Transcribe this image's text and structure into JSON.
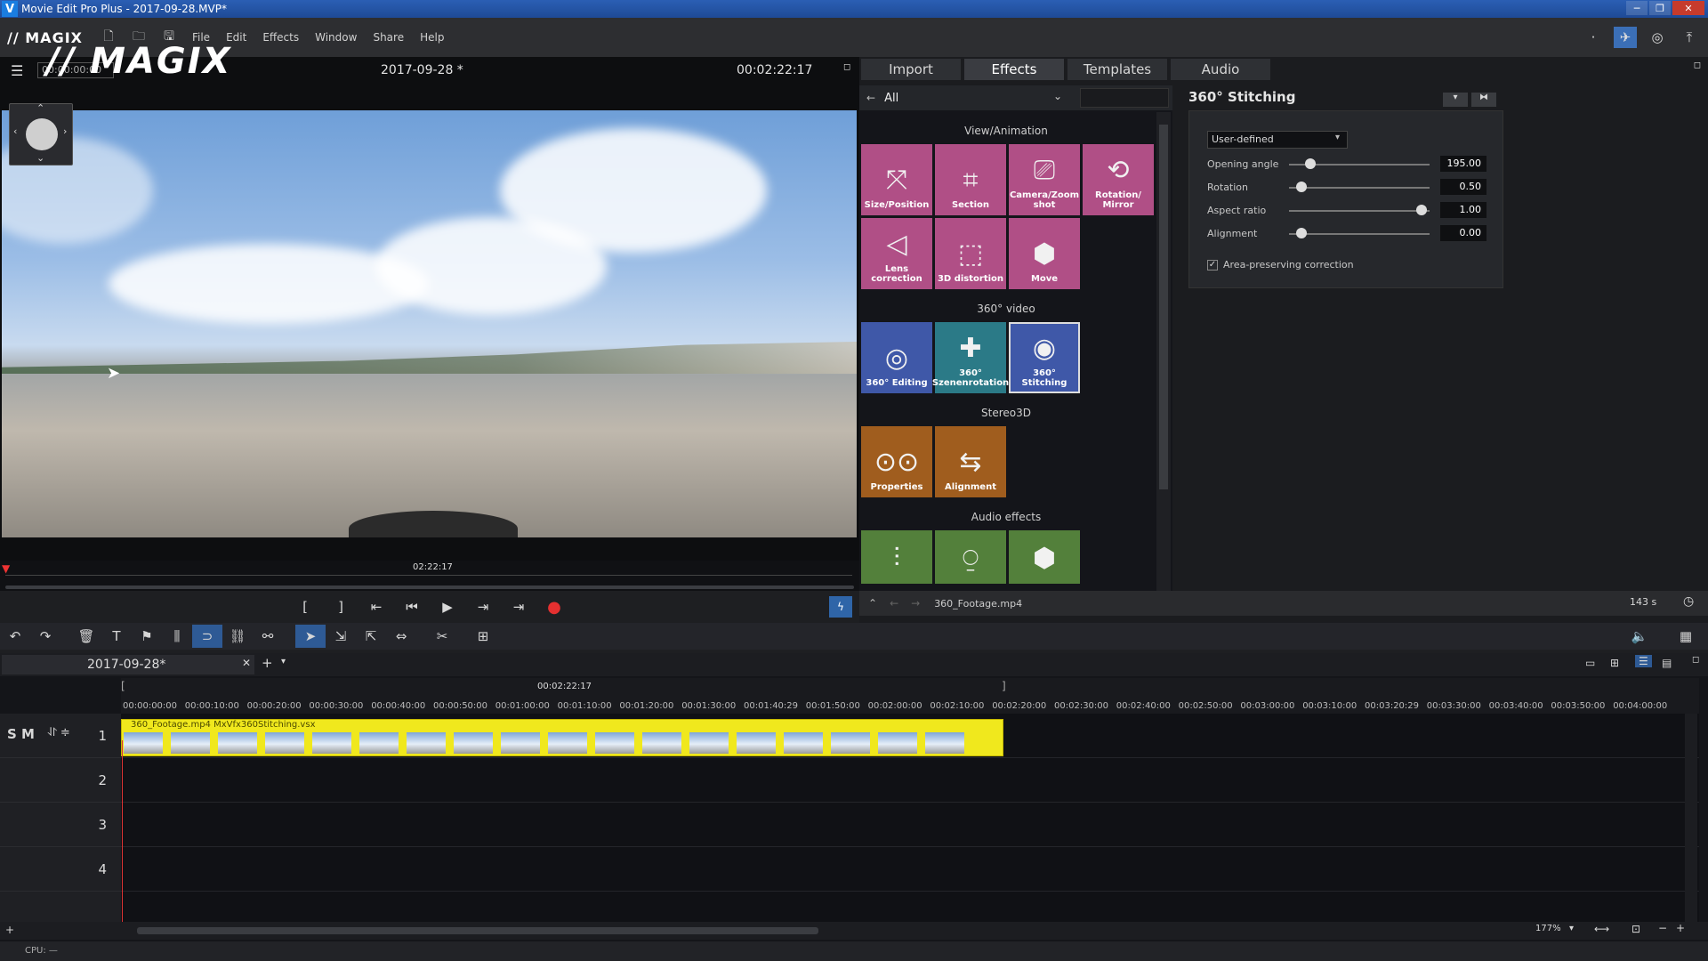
{
  "window": {
    "title": "Movie Edit Pro Plus - 2017-09-28.MVP*",
    "logo_letter": "V"
  },
  "menu": {
    "brand": "// MAGIX",
    "items": [
      "File",
      "Edit",
      "Effects",
      "Window",
      "Share",
      "Help"
    ]
  },
  "preview": {
    "brand": "// MAGIX",
    "timecode_field": "00:00:00:00",
    "project_title": "2017-09-28 *",
    "position": "00:02:22:17",
    "scrub_label": "02:22:17"
  },
  "tabs": [
    "Import",
    "Effects",
    "Templates",
    "Audio"
  ],
  "active_tab": "Effects",
  "effects_browser": {
    "category": "All",
    "sections": {
      "view": "View/Animation",
      "video360": "360° video",
      "stereo": "Stereo3D",
      "audio": "Audio effects"
    },
    "tiles": {
      "size_position": "Size/Position",
      "section": "Section",
      "camera_zoom": "Camera/Zoom shot",
      "rotation_mirror": "Rotation/ Mirror",
      "lens_correction": "Lens correction",
      "distortion3d": "3D distortion",
      "move": "Move",
      "editing360": "360° Editing",
      "szenenrotation": "360° Szenenrotation",
      "stitching360": "360° Stitching",
      "properties": "Properties",
      "alignment": "Alignment"
    },
    "status_file": "360_Footage.mp4",
    "status_duration": "143 s"
  },
  "settings": {
    "title": "360° Stitching",
    "preset": "User-defined",
    "params": [
      {
        "label": "Opening angle",
        "value": "195.00",
        "level": 0.12
      },
      {
        "label": "Rotation",
        "value": "0.50",
        "level": 0.05
      },
      {
        "label": "Aspect ratio",
        "value": "1.00",
        "level": 0.95
      },
      {
        "label": "Alignment",
        "value": "0.00",
        "level": 0.05
      }
    ],
    "checkbox_label": "Area-preserving correction"
  },
  "timeline": {
    "project_tab": "2017-09-28*",
    "marker_time": "00:02:22:17",
    "ruler": [
      "00:00:00:00",
      "00:00:10:00",
      "00:00:20:00",
      "00:00:30:00",
      "00:00:40:00",
      "00:00:50:00",
      "00:01:00:00",
      "00:01:10:00",
      "00:01:20:00",
      "00:01:30:00",
      "00:01:40:29",
      "00:01:50:00",
      "00:02:00:00",
      "00:02:10:00",
      "00:02:20:00",
      "00:02:30:00",
      "00:02:40:00",
      "00:02:50:00",
      "00:03:00:00",
      "00:03:10:00",
      "00:03:20:29",
      "00:03:30:00",
      "00:03:40:00",
      "00:03:50:00",
      "00:04:00:00"
    ],
    "track_numbers": [
      "1",
      "2",
      "3",
      "4"
    ],
    "track_flags": "S M",
    "clip_label": "360_Footage.mp4   MxVfx360Stitching.vsx",
    "zoom": "177%"
  },
  "status": {
    "cpu": "CPU: —"
  }
}
